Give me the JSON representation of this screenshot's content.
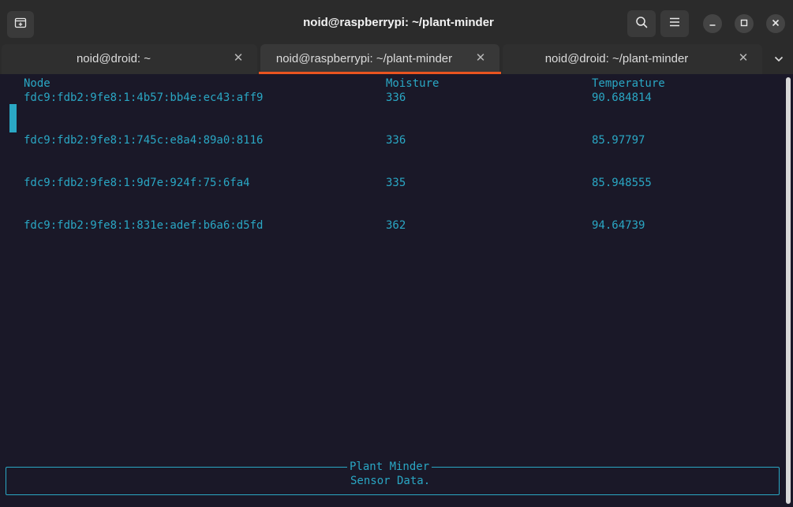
{
  "window": {
    "title": "noid@raspberrypi: ~/plant-minder"
  },
  "headerbar": {
    "icons": {
      "new_tab": "new-tab-icon",
      "search": "search-icon",
      "menu": "hamburger-menu-icon",
      "minimize": "minimize-icon",
      "maximize": "maximize-icon",
      "close": "close-icon"
    }
  },
  "tabs": [
    {
      "label": "noid@droid: ~",
      "active": false
    },
    {
      "label": "noid@raspberrypi: ~/plant-minder",
      "active": true
    },
    {
      "label": "noid@droid: ~/plant-minder",
      "active": false
    }
  ],
  "tab_close_glyph": "✕",
  "terminal": {
    "headers": {
      "node": "Node",
      "moisture": "Moisture",
      "temperature": "Temperature"
    },
    "rows": [
      {
        "node": "fdc9:fdb2:9fe8:1:4b57:bb4e:ec43:aff9",
        "moisture": "336",
        "temperature": "90.684814"
      },
      {
        "node": "fdc9:fdb2:9fe8:1:745c:e8a4:89a0:8116",
        "moisture": "336",
        "temperature": "85.97797"
      },
      {
        "node": "fdc9:fdb2:9fe8:1:9d7e:924f:75:6fa4",
        "moisture": "335",
        "temperature": "85.948555"
      },
      {
        "node": "fdc9:fdb2:9fe8:1:831e:adef:b6a6:d5fd",
        "moisture": "362",
        "temperature": "94.64739"
      }
    ],
    "footer": {
      "title": "Plant Minder",
      "subtitle": "Sensor Data."
    }
  },
  "colors": {
    "accent": "#e95420",
    "terminal_text": "#2aa7c4",
    "terminal_bg": "#1a1828",
    "headerbar_bg": "#2b2b2b"
  }
}
